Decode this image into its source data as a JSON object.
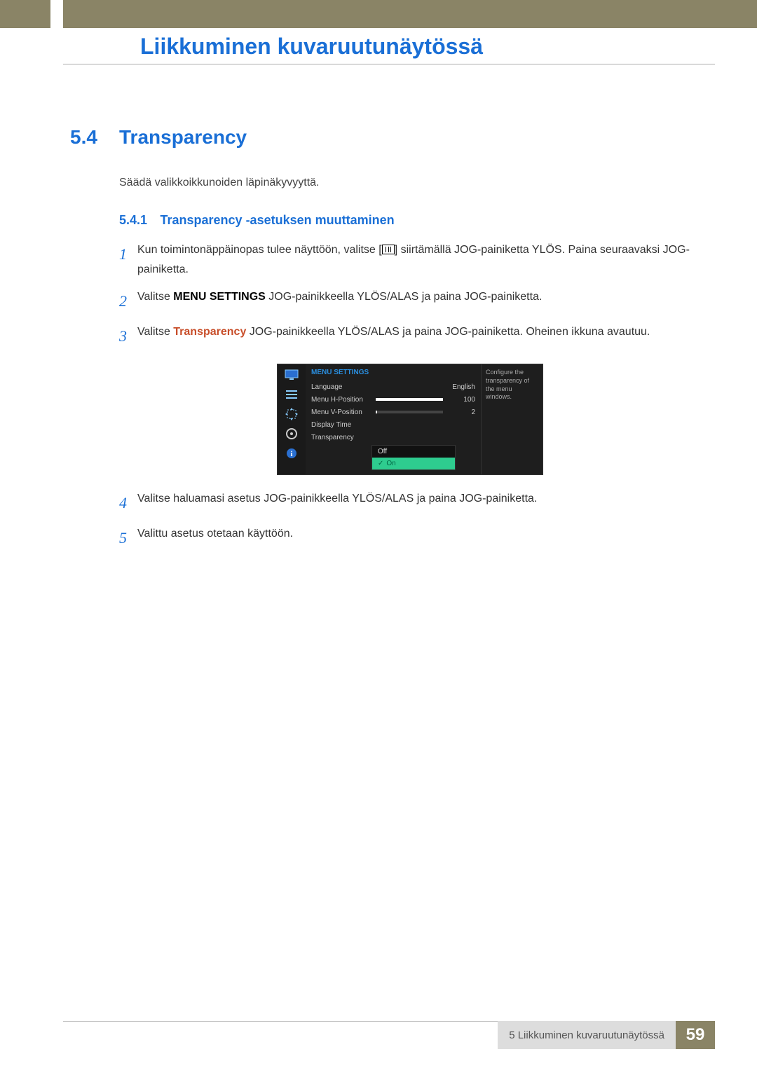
{
  "header": {
    "chapter_number": "5",
    "title": "Liikkuminen kuvaruutunäytössä"
  },
  "section": {
    "number": "5.4",
    "title": "Transparency",
    "intro": "Säädä valikkoikkunoiden läpinäkyvyyttä."
  },
  "subsection": {
    "number": "5.4.1",
    "title": "Transparency -asetuksen muuttaminen"
  },
  "steps": [
    {
      "n": "1",
      "pre": "Kun toimintonäppäinopas tulee näyttöön, valitse [",
      "post": "] siirtämällä JOG-painiketta YLÖS. Paina seuraavaksi JOG-painiketta."
    },
    {
      "n": "2",
      "pre": "Valitse ",
      "bold": "MENU SETTINGS",
      "post": " JOG-painikkeella YLÖS/ALAS ja paina JOG-painiketta."
    },
    {
      "n": "3",
      "pre": "Valitse ",
      "accent": "Transparency",
      "post": " JOG-painikkeella YLÖS/ALAS ja paina JOG-painiketta. Oheinen ikkuna avautuu."
    },
    {
      "n": "4",
      "text": "Valitse haluamasi asetus JOG-painikkeella YLÖS/ALAS ja paina JOG-painiketta."
    },
    {
      "n": "5",
      "text": "Valittu asetus otetaan käyttöön."
    }
  ],
  "osd": {
    "title": "MENU SETTINGS",
    "rows": [
      {
        "label": "Language",
        "value": "English",
        "type": "text"
      },
      {
        "label": "Menu H-Position",
        "value": "100",
        "type": "slider",
        "pct": 100
      },
      {
        "label": "Menu V-Position",
        "value": "2",
        "type": "slider",
        "pct": 2
      },
      {
        "label": "Display Time",
        "value": "",
        "type": "text"
      },
      {
        "label": "Transparency",
        "value": "",
        "type": "text"
      }
    ],
    "options": [
      {
        "label": "Off",
        "selected": false
      },
      {
        "label": "On",
        "selected": true
      }
    ],
    "description": "Configure the transparency of the menu windows."
  },
  "footer": {
    "text": "5 Liikkuminen kuvaruutunäytössä",
    "page": "59"
  }
}
